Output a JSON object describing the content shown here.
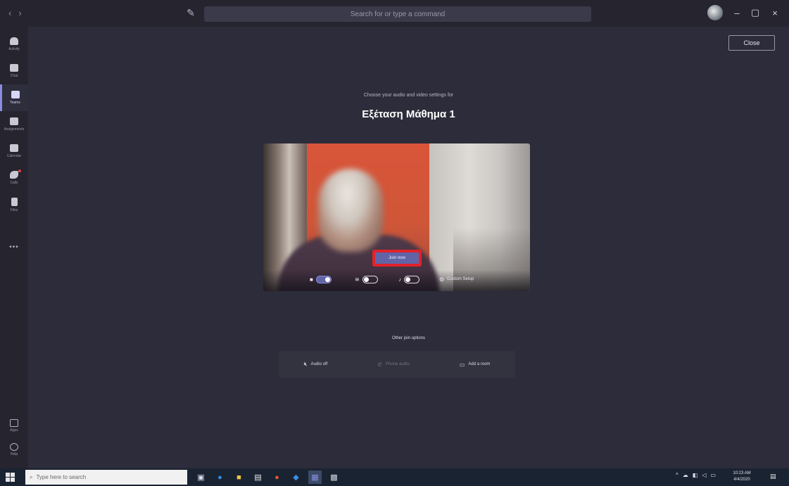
{
  "titlebar": {
    "back_glyph": "‹",
    "forward_glyph": "›",
    "search_placeholder": "Search for or type a command",
    "minimize_glyph": "–",
    "maximize_glyph": "▢",
    "close_glyph": "×"
  },
  "rail": {
    "items": [
      {
        "label": "Activity",
        "icon": "bell-icon"
      },
      {
        "label": "Chat",
        "icon": "chat-icon"
      },
      {
        "label": "Teams",
        "icon": "teams-icon"
      },
      {
        "label": "Assignments",
        "icon": "assignments-icon"
      },
      {
        "label": "Calendar",
        "icon": "calendar-icon"
      },
      {
        "label": "Calls",
        "icon": "phone-icon"
      },
      {
        "label": "Files",
        "icon": "file-icon"
      }
    ],
    "more": "•••",
    "bottom": [
      {
        "label": "Apps",
        "icon": "apps-icon"
      },
      {
        "label": "Help",
        "icon": "help-icon"
      }
    ]
  },
  "main": {
    "close_label": "Close",
    "subtitle": "Choose your audio and video settings for",
    "meeting_title": "Εξέταση Μάθημα 1",
    "join_label": "Join now",
    "controls": {
      "camera_icon": "■",
      "blur_icon": "≋",
      "mic_icon": "♪",
      "settings_icon": "⚙",
      "device_settings": "Custom Setup"
    },
    "other_options": {
      "heading": "Other join options",
      "audio_off": "Audio off",
      "phone_audio": "Phone audio",
      "add_room": "Add a room"
    }
  },
  "taskbar": {
    "search_placeholder": "Type here to search",
    "clock_time": "10:23 AM",
    "clock_date": "4/4/2020",
    "tray_up": "^"
  },
  "colors": {
    "accent": "#6264a7",
    "highlight": "#e2222a",
    "background": "#2d2c3a",
    "rail": "#25242f"
  }
}
